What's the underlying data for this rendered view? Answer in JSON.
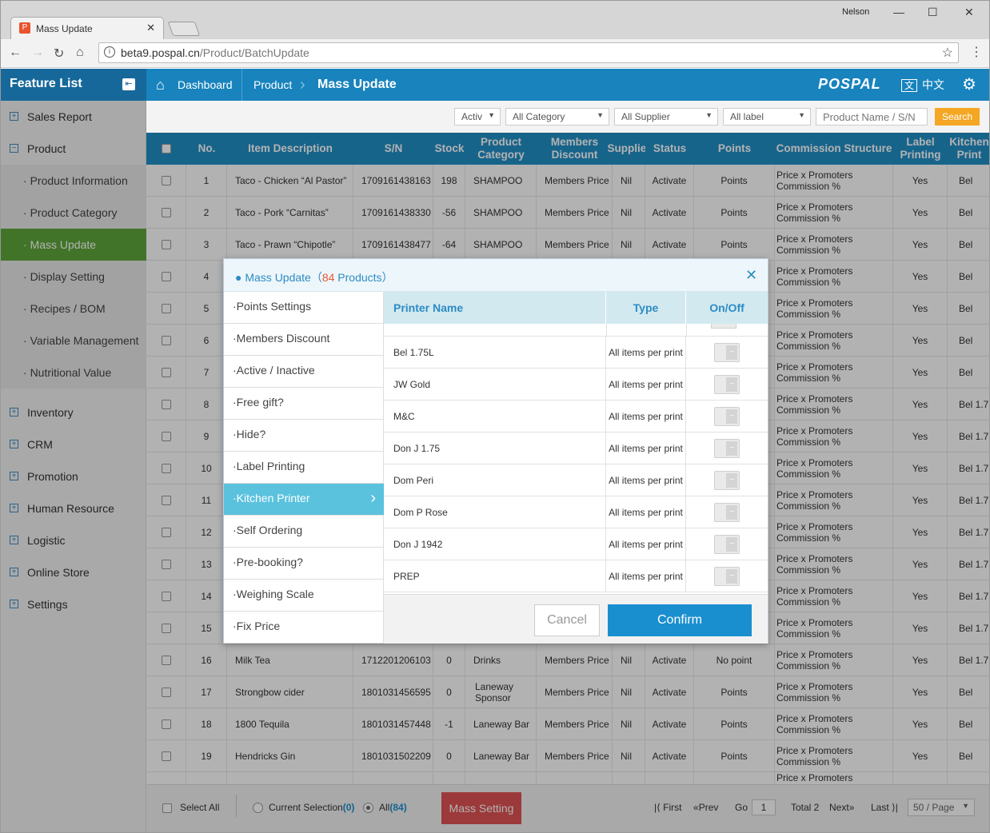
{
  "browser": {
    "tab_title": "Mass Update",
    "user": "Nelson",
    "url_host": "beta9.pospal.cn",
    "url_path": "/Product/BatchUpdate"
  },
  "header": {
    "sidebar_title": "Feature List",
    "breadcrumb": [
      "Dashboard",
      "Product",
      "Mass Update"
    ],
    "logo": "POSPAL",
    "lang": "中文"
  },
  "sidebar": {
    "top": [
      {
        "label": "Sales Report",
        "sign": "+"
      },
      {
        "label": "Product",
        "sign": "−"
      }
    ],
    "sub": [
      "Product Information",
      "Product Category",
      "Mass Update",
      "Display Setting",
      "Recipes / BOM",
      "Variable Management",
      "Nutritional Value"
    ],
    "bottom": [
      "Inventory",
      "CRM",
      "Promotion",
      "Human Resource",
      "Logistic",
      "Online Store",
      "Settings"
    ]
  },
  "filters": {
    "status": "Activ",
    "category": "All Category",
    "supplier": "All Supplier",
    "label": "All label",
    "search_placeholder": "Product Name / S/N",
    "search_btn": "Search"
  },
  "table": {
    "headers": [
      "No.",
      "Item Description",
      "S/N",
      "Stock",
      "Product Category",
      "Members Discount",
      "Supplier",
      "Status",
      "Points",
      "Commission Structure",
      "Label Printing",
      "Kitchen Print"
    ],
    "rows": [
      [
        "1",
        "Taco - Chicken “Al Pastor”",
        "1709161438163",
        "198",
        "SHAMPOO",
        "Members Price",
        "Nil",
        "Activate",
        "Points",
        "Price x Promoters Commission %",
        "Yes",
        "Bel"
      ],
      [
        "2",
        "Taco - Pork “Carnitas”",
        "1709161438330",
        "-56",
        "SHAMPOO",
        "Members Price",
        "Nil",
        "Activate",
        "Points",
        "Price x Promoters Commission %",
        "Yes",
        "Bel"
      ],
      [
        "3",
        "Taco - Prawn “Chipotle”",
        "1709161438477",
        "-64",
        "SHAMPOO",
        "Members Price",
        "Nil",
        "Activate",
        "Points",
        "Price x Promoters Commission %",
        "Yes",
        "Bel"
      ],
      [
        "4",
        "",
        "",
        "",
        "",
        "",
        "",
        "",
        "",
        "Price x Promoters Commission %",
        "Yes",
        "Bel"
      ],
      [
        "5",
        "",
        "",
        "",
        "",
        "",
        "",
        "",
        "",
        "Price x Promoters Commission %",
        "Yes",
        "Bel"
      ],
      [
        "6",
        "",
        "",
        "",
        "",
        "",
        "",
        "",
        "",
        "Price x Promoters Commission %",
        "Yes",
        "Bel"
      ],
      [
        "7",
        "",
        "",
        "",
        "",
        "",
        "",
        "",
        "",
        "Price x Promoters Commission %",
        "Yes",
        "Bel"
      ],
      [
        "8",
        "",
        "",
        "",
        "",
        "",
        "",
        "",
        "",
        "Price x Promoters Commission %",
        "Yes",
        "Bel 1.7"
      ],
      [
        "9",
        "",
        "",
        "",
        "",
        "",
        "",
        "",
        "",
        "Price x Promoters Commission %",
        "Yes",
        "Bel 1.7"
      ],
      [
        "10",
        "",
        "",
        "",
        "",
        "",
        "",
        "",
        "",
        "Price x Promoters Commission %",
        "Yes",
        "Bel 1.7"
      ],
      [
        "11",
        "",
        "",
        "",
        "",
        "",
        "",
        "",
        "",
        "Price x Promoters Commission %",
        "Yes",
        "Bel 1.7"
      ],
      [
        "12",
        "",
        "",
        "",
        "",
        "",
        "",
        "",
        "",
        "Price x Promoters Commission %",
        "Yes",
        "Bel 1.7"
      ],
      [
        "13",
        "",
        "",
        "",
        "",
        "",
        "",
        "",
        "",
        "Price x Promoters Commission %",
        "Yes",
        "Bel 1.7"
      ],
      [
        "14",
        "",
        "",
        "",
        "",
        "",
        "",
        "",
        "",
        "Price x Promoters Commission %",
        "Yes",
        "Bel 1.7"
      ],
      [
        "15",
        "",
        "",
        "",
        "",
        "",
        "",
        "",
        "",
        "Price x Promoters Commission %",
        "Yes",
        "Bel 1.7"
      ],
      [
        "16",
        "Milk Tea",
        "1712201206103",
        "0",
        "Drinks",
        "Members Price",
        "Nil",
        "Activate",
        "No point",
        "Price x Promoters Commission %",
        "Yes",
        "Bel 1.7"
      ],
      [
        "17",
        "Strongbow cider",
        "1801031456595",
        "0",
        "Laneway Sponsor",
        "Members Price",
        "Nil",
        "Activate",
        "Points",
        "Price x Promoters Commission %",
        "Yes",
        "Bel"
      ],
      [
        "18",
        "1800 Tequila",
        "1801031457448",
        "-1",
        "Laneway Bar",
        "Members Price",
        "Nil",
        "Activate",
        "Points",
        "Price x Promoters Commission %",
        "Yes",
        "Bel"
      ],
      [
        "19",
        "Hendricks Gin",
        "1801031502209",
        "0",
        "Laneway Bar",
        "Members Price",
        "Nil",
        "Activate",
        "Points",
        "Price x Promoters Commission %",
        "Yes",
        "Bel"
      ],
      [
        "",
        "",
        "",
        "",
        "",
        "",
        "",
        "",
        "",
        "Price x Promoters",
        "",
        ""
      ]
    ]
  },
  "footer": {
    "select_all": "Select All",
    "current_selection": "Current Selection",
    "current_count": "(0)",
    "all": "All",
    "all_count": "(84)",
    "mass_setting": "Mass Setting",
    "first": "First",
    "prev": "Prev",
    "go": "Go",
    "page": "1",
    "total": "Total 2",
    "next": "Next",
    "last": "Last",
    "per_page": "50 / Page"
  },
  "modal": {
    "title_prefix": "Mass Update（",
    "count": "84",
    "title_suffix": " Products）",
    "menu": [
      "Points Settings",
      "Members Discount",
      "Active / Inactive",
      "Free gift?",
      "Hide?",
      "Label Printing",
      "Kitchen Printer",
      "Self Ordering",
      "Pre-booking?",
      "Weighing Scale",
      "Fix Price"
    ],
    "active_index": 6,
    "col_printer": "Printer Name",
    "col_type": "Type",
    "col_onoff": "On/Off",
    "printers": [
      {
        "name": "Bel 1.75L",
        "type": "All items per print",
        "on": false
      },
      {
        "name": "JW Gold",
        "type": "All items per print",
        "on": false
      },
      {
        "name": "M&C",
        "type": "All items per print",
        "on": false
      },
      {
        "name": "Don J 1.75",
        "type": "All items per print",
        "on": false
      },
      {
        "name": "Dom Peri",
        "type": "All items per print",
        "on": false
      },
      {
        "name": "Dom P Rose",
        "type": "All items per print",
        "on": false
      },
      {
        "name": "Don J 1942",
        "type": "All items per print",
        "on": false
      },
      {
        "name": "PREP",
        "type": "All items per print",
        "on": false
      }
    ],
    "cancel": "Cancel",
    "confirm": "Confirm"
  }
}
